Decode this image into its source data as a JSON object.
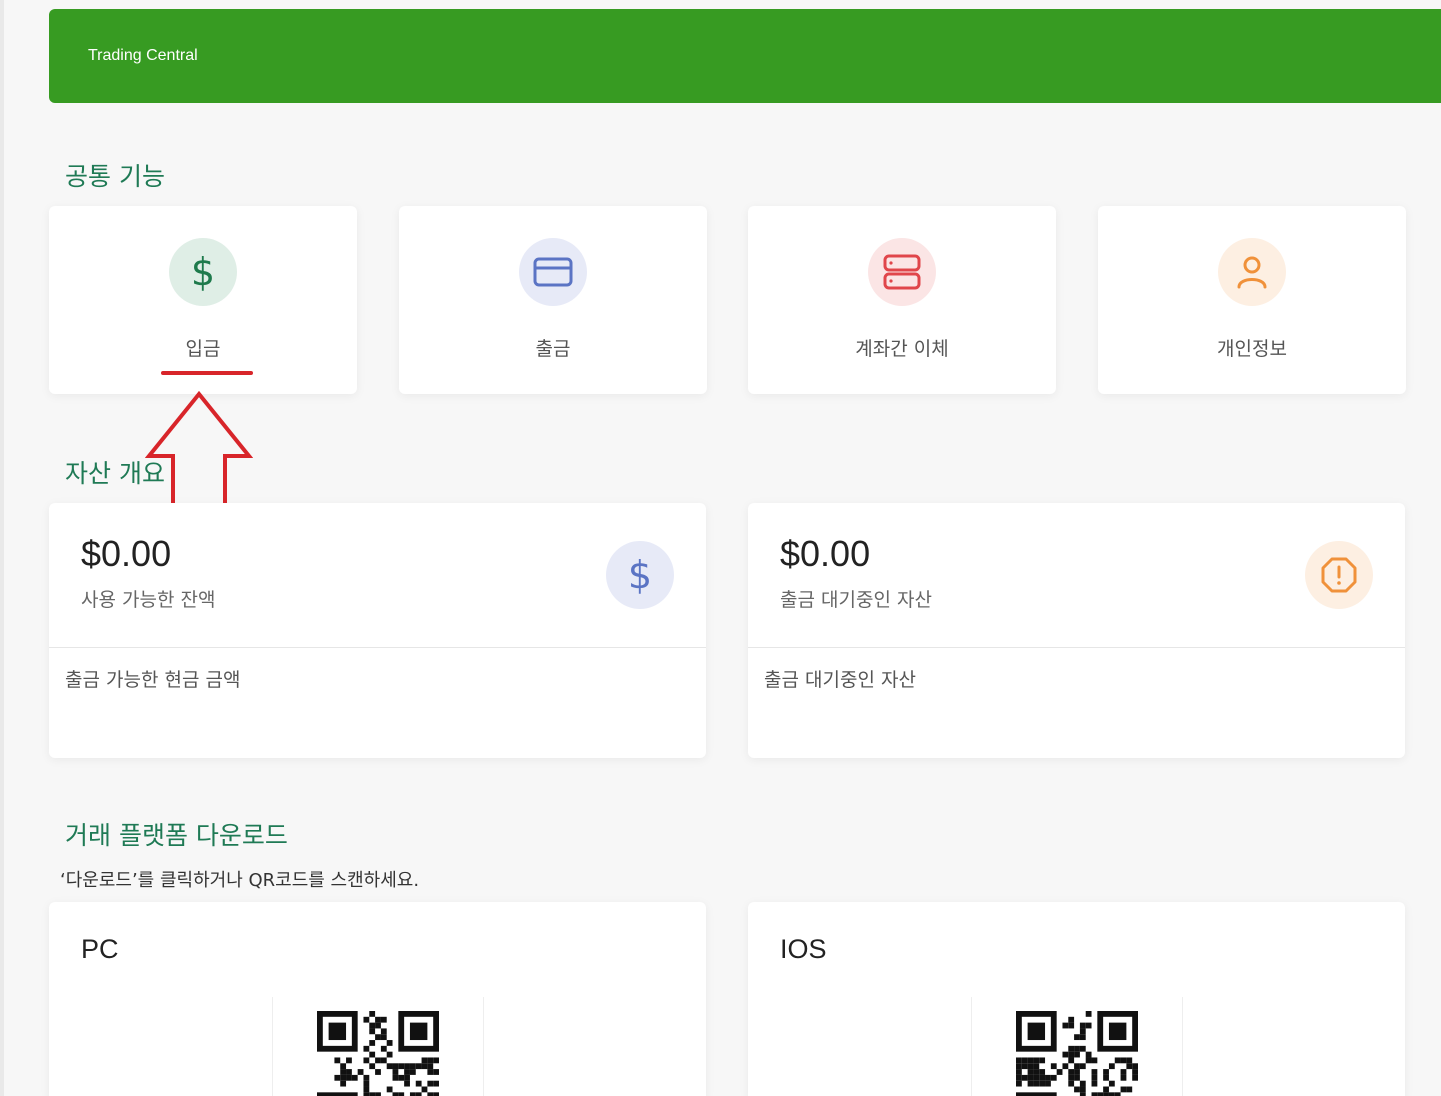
{
  "banner": {
    "title": "Trading Central"
  },
  "sections": {
    "common": "공통 기능",
    "assets": "자산 개요",
    "download": "거래 플랫폼 다운로드"
  },
  "actions": [
    {
      "label": "입금",
      "icon": "dollar-icon",
      "color": "#1e7a4c",
      "bg": "#dfeee6"
    },
    {
      "label": "출금",
      "icon": "credit-card-icon",
      "color": "#5b74c4",
      "bg": "#e7eaf7"
    },
    {
      "label": "계좌간 이체",
      "icon": "server-icon",
      "color": "#e0464b",
      "bg": "#fbe5e5"
    },
    {
      "label": "개인정보",
      "icon": "user-icon",
      "color": "#f0913a",
      "bg": "#fdefe2"
    }
  ],
  "assets": [
    {
      "amount": "$0.00",
      "label": "사용 가능한 잔액",
      "footer": "출금 가능한 현금 금액",
      "icon": "dollar-icon",
      "color": "#5b74c4",
      "bg": "#e7eaf7"
    },
    {
      "amount": "$0.00",
      "label": "출금 대기중인 자산",
      "footer": "출금 대기중인 자산",
      "icon": "alert-octagon-icon",
      "color": "#f0913a",
      "bg": "#fdefe2"
    }
  ],
  "download": {
    "hint": "‘다운로드’를 클릭하거나 QR코드를 스캔하세요.",
    "platforms": [
      {
        "name": "PC",
        "qr": "qr-code-icon"
      },
      {
        "name": "IOS",
        "qr": "qr-code-icon"
      }
    ]
  },
  "annotation": {
    "color": "#d8252a"
  }
}
